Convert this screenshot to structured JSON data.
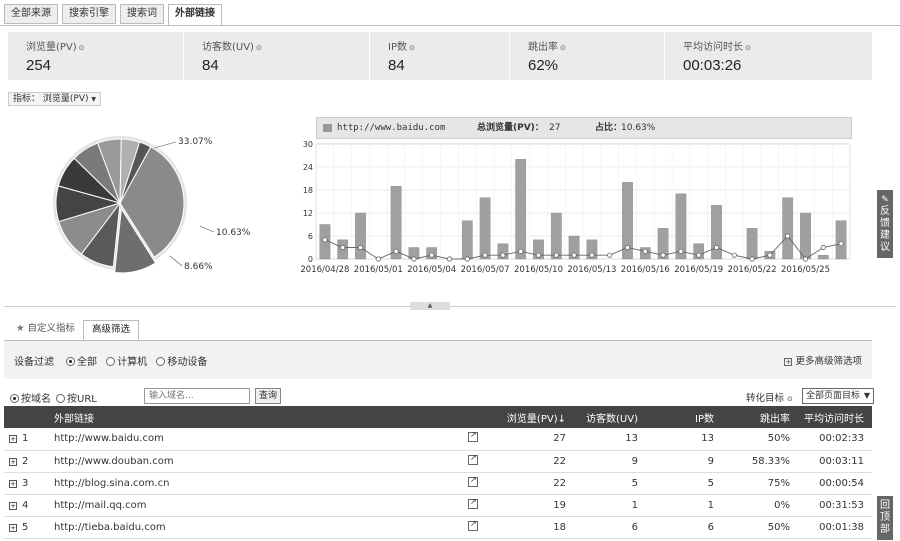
{
  "tabs": [
    {
      "label": "全部来源",
      "active": false
    },
    {
      "label": "搜索引擎",
      "active": false
    },
    {
      "label": "搜索词",
      "active": false
    },
    {
      "label": "外部链接",
      "active": true
    }
  ],
  "metrics": [
    {
      "label": "浏览量(PV)",
      "value": "254"
    },
    {
      "label": "访客数(UV)",
      "value": "84"
    },
    {
      "label": "IP数",
      "value": "84"
    },
    {
      "label": "跳出率",
      "value": "62%"
    },
    {
      "label": "平均访问时长",
      "value": "00:03:26"
    }
  ],
  "indicator": {
    "label": "指标：",
    "value": "浏览量(PV)",
    "caret": "▼"
  },
  "pie": {
    "labels": [
      "33.07%",
      "10.63%",
      "8.66%"
    ],
    "slices": [
      33.07,
      10.63,
      8.66,
      10,
      9,
      8,
      7,
      6,
      4.64,
      3
    ]
  },
  "chart_legend": {
    "series_name": "http://www.baidu.com",
    "total_label": "总浏览量(PV)：",
    "total_value": "27",
    "ratio_label": "占比：",
    "ratio_value": "10.63%"
  },
  "chart_data": {
    "type": "bar",
    "x_tick_labels": [
      "2016/04/28",
      "2016/05/01",
      "2016/05/04",
      "2016/05/07",
      "2016/05/10",
      "2016/05/13",
      "2016/05/16",
      "2016/05/19",
      "2016/05/22",
      "2016/05/25"
    ],
    "y_ticks": [
      0,
      6,
      12,
      18,
      24,
      30
    ],
    "ylim": [
      0,
      30
    ],
    "bars": [
      9,
      5,
      12,
      0,
      19,
      3,
      3,
      0,
      10,
      16,
      4,
      26,
      5,
      12,
      6,
      5,
      0,
      20,
      3,
      8,
      17,
      4,
      14,
      0,
      8,
      2,
      16,
      12,
      1,
      10
    ],
    "line": [
      5,
      3,
      3,
      0,
      2,
      0,
      1,
      0,
      0,
      1,
      1,
      2,
      1,
      1,
      1,
      1,
      1,
      3,
      2,
      1,
      2,
      1,
      3,
      1,
      0,
      1,
      6,
      0,
      3,
      4
    ]
  },
  "subtabs": [
    {
      "label": "自定义指标",
      "active": false,
      "icon": "star-icon"
    },
    {
      "label": "高级筛选",
      "active": true
    }
  ],
  "filter": {
    "label": "设备过滤",
    "options": [
      {
        "label": "全部",
        "selected": true
      },
      {
        "label": "计算机",
        "selected": false
      },
      {
        "label": "移动设备",
        "selected": false
      }
    ],
    "more": "更多高级筛选项"
  },
  "search": {
    "by_domain": "按域名",
    "by_url": "按URL",
    "placeholder": "输入域名...",
    "button": "查询",
    "conversion_label": "转化目标",
    "conversion_value": "全部页面目标"
  },
  "table": {
    "headers": {
      "url": "外部链接",
      "pv": "浏览量(PV)",
      "uv": "访客数(UV)",
      "ip": "IP数",
      "bounce": "跳出率",
      "avg": "平均访问时长"
    },
    "rows": [
      {
        "no": "1",
        "url": "http://www.baidu.com",
        "pv": "27",
        "uv": "13",
        "ip": "13",
        "bounce": "50%",
        "avg": "00:02:33"
      },
      {
        "no": "2",
        "url": "http://www.douban.com",
        "pv": "22",
        "uv": "9",
        "ip": "9",
        "bounce": "58.33%",
        "avg": "00:03:11"
      },
      {
        "no": "3",
        "url": "http://blog.sina.com.cn",
        "pv": "22",
        "uv": "5",
        "ip": "5",
        "bounce": "75%",
        "avg": "00:00:54"
      },
      {
        "no": "4",
        "url": "http://mail.qq.com",
        "pv": "19",
        "uv": "1",
        "ip": "1",
        "bounce": "0%",
        "avg": "00:31:53"
      },
      {
        "no": "5",
        "url": "http://tieba.baidu.com",
        "pv": "18",
        "uv": "6",
        "ip": "6",
        "bounce": "50%",
        "avg": "00:01:38"
      }
    ]
  },
  "side": {
    "feedback": [
      "反",
      "馈",
      "建",
      "议"
    ],
    "back_top": [
      "回",
      "顶",
      "部"
    ]
  }
}
